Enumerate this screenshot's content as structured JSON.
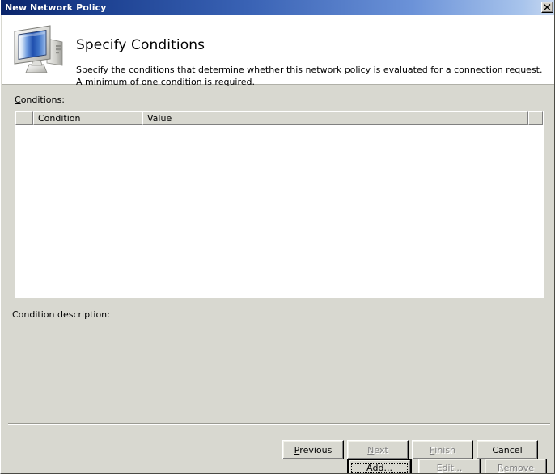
{
  "window": {
    "title": "New Network Policy",
    "close_icon": "close-icon",
    "close_label": "Close"
  },
  "banner": {
    "icon": "computer-monitor-icon",
    "heading": "Specify Conditions",
    "description": "Specify the conditions that determine whether this network policy is evaluated for a connection request. A minimum of one condition is required."
  },
  "conditions": {
    "label_prefix": "C",
    "label_rest": "onditions:",
    "columns": [
      "",
      "Condition",
      "Value",
      ""
    ],
    "rows": []
  },
  "description_panel": {
    "label": "Condition description:",
    "text": ""
  },
  "action_buttons": [
    {
      "name": "add-button",
      "label_pre": "A",
      "label_acc": "d",
      "label_post": "d...",
      "enabled": true,
      "default": true
    },
    {
      "name": "edit-button",
      "label_pre": "",
      "label_acc": "E",
      "label_post": "dit...",
      "enabled": false,
      "default": false
    },
    {
      "name": "remove-button",
      "label_pre": "",
      "label_acc": "R",
      "label_post": "emove",
      "enabled": false,
      "default": false
    }
  ],
  "nav_buttons": [
    {
      "name": "previous-button",
      "label_pre": "",
      "label_acc": "P",
      "label_post": "revious",
      "enabled": true
    },
    {
      "name": "next-button",
      "label_pre": "",
      "label_acc": "N",
      "label_post": "ext",
      "enabled": false
    },
    {
      "name": "finish-button",
      "label_pre": "",
      "label_acc": "F",
      "label_post": "inish",
      "enabled": false
    },
    {
      "name": "cancel-button",
      "label_pre": "Cancel",
      "label_acc": "",
      "label_post": "",
      "enabled": true
    }
  ],
  "colors": {
    "titlebar_start": "#0a246a",
    "titlebar_end": "#c9d9f0",
    "dialog_face": "#d8d8d0",
    "banner_bg": "#ffffff",
    "disabled_text": "#808080"
  }
}
